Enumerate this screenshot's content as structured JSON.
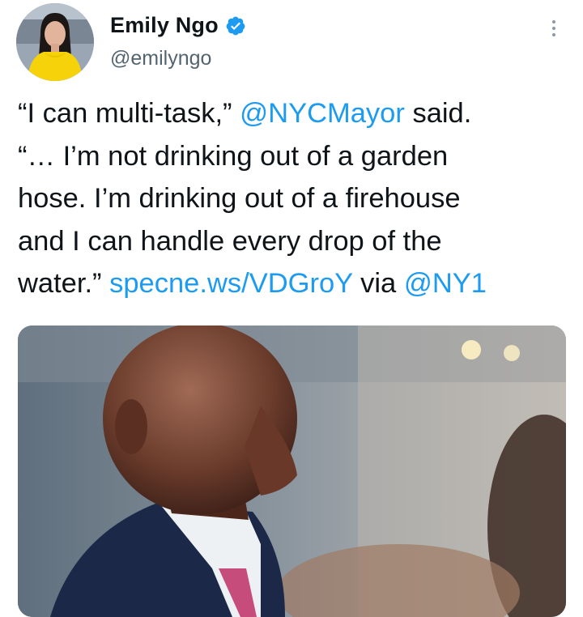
{
  "author": {
    "display_name": "Emily Ngo",
    "handle": "@emilyngo",
    "verified": true,
    "avatar_icon": "profile-photo-woman-yellow-top"
  },
  "tweet": {
    "line1": {
      "t1": "“I can multi-task,” ",
      "mention": "@NYCMayor",
      "t2": " said."
    },
    "line2": "“… I’m not drinking out of a garden",
    "line3": "hose. I’m drinking out of a firehouse",
    "line4": "and I can handle every drop of the",
    "line5": {
      "t1": "water.” ",
      "link": "specne.ws/VDGroY",
      "t2": " via ",
      "mention": "@NY1"
    }
  },
  "media": {
    "description_icon": "photo-man-in-suit-profile"
  },
  "colors": {
    "link": "#1d9bf0",
    "text": "#0f1419",
    "secondary": "#536471",
    "verified": "#1d9bf0"
  },
  "icons": {
    "more": "more-vertical-icon",
    "verified": "verified-badge-icon"
  }
}
